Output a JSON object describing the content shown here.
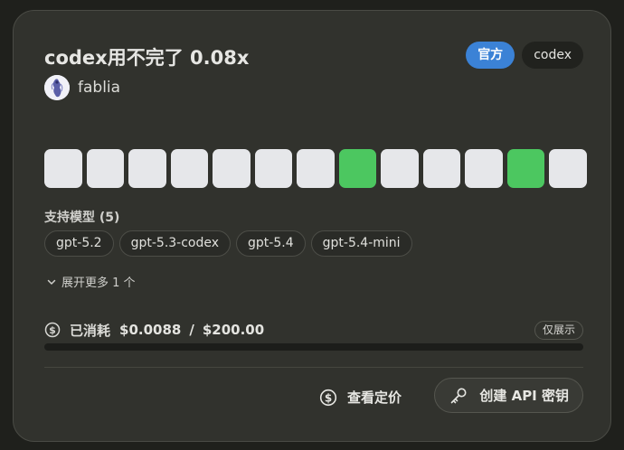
{
  "card": {
    "title": "codex用不完了 0.08x",
    "badges": {
      "official": "官方",
      "tag": "codex"
    },
    "owner": {
      "name": "fablia"
    },
    "status_cells": [
      "down",
      "down",
      "down",
      "down",
      "down",
      "down",
      "down",
      "up",
      "down",
      "down",
      "down",
      "up",
      "down"
    ],
    "models": {
      "heading": "支持模型 (5)",
      "items": [
        "gpt-5.2",
        "gpt-5.3-codex",
        "gpt-5.4",
        "gpt-5.4-mini"
      ],
      "expand_label": "展开更多 1 个"
    },
    "usage": {
      "label": "已消耗",
      "spent": "$0.0088",
      "separator": "/",
      "limit": "$200.00",
      "fraction": 4.4e-05,
      "badge": "仅展示"
    },
    "actions": {
      "pricing_label": "查看定价",
      "create_key_label": "创建 API 密钥"
    }
  },
  "colors": {
    "accent": "#3b82d6",
    "up": "#4cc760",
    "down": "#e6e7ea"
  }
}
